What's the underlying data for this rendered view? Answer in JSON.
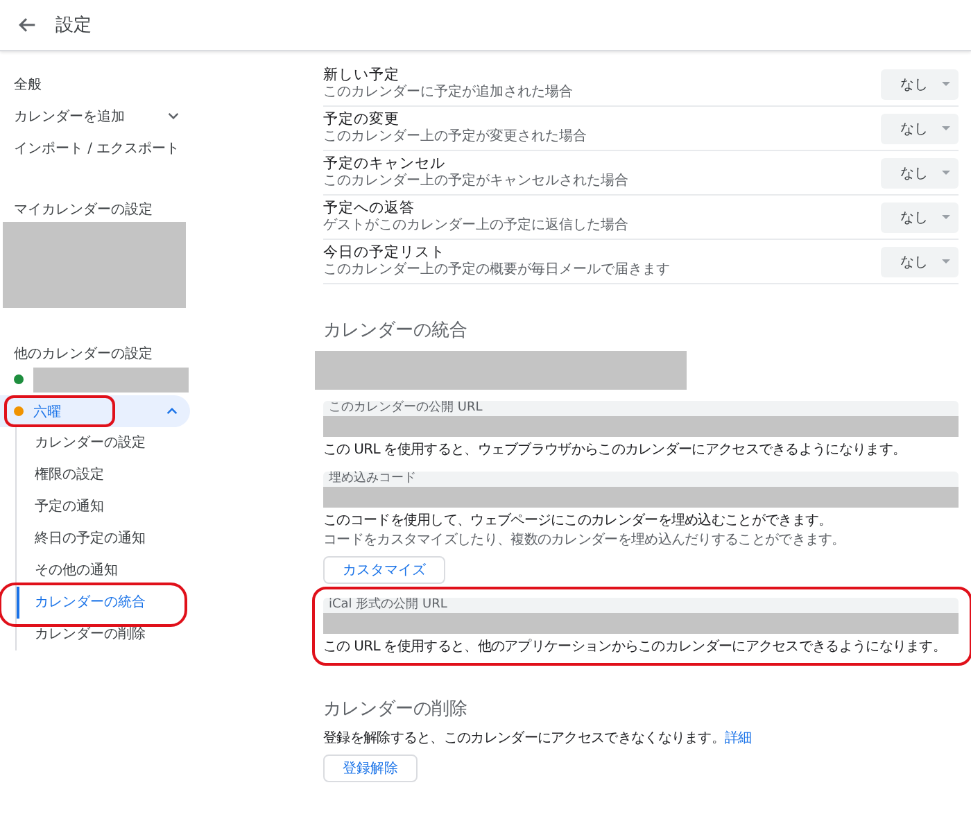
{
  "header": {
    "title": "設定"
  },
  "sidebar": {
    "nav": [
      {
        "label": "全般",
        "kind": "link"
      },
      {
        "label": "カレンダーを追加",
        "kind": "dropdown"
      },
      {
        "label": "インポート / エクスポート",
        "kind": "link"
      }
    ],
    "my_calendars": {
      "heading": "マイカレンダーの設定"
    },
    "other_calendars": {
      "heading": "他のカレンダーの設定",
      "calendars": [
        {
          "color": "#1e8e3e",
          "selected": false,
          "annotated": false
        },
        {
          "name": "六曜",
          "color": "#f09300",
          "selected": true,
          "expanded": true,
          "annotated": true,
          "children": [
            {
              "label": "カレンダーの設定",
              "selected": false,
              "annotated": false
            },
            {
              "label": "権限の設定",
              "selected": false,
              "annotated": false
            },
            {
              "label": "予定の通知",
              "selected": false,
              "annotated": false
            },
            {
              "label": "終日の予定の通知",
              "selected": false,
              "annotated": false
            },
            {
              "label": "その他の通知",
              "selected": false,
              "annotated": false
            },
            {
              "label": "カレンダーの統合",
              "selected": true,
              "annotated": true
            },
            {
              "label": "カレンダーの削除",
              "selected": false,
              "annotated": false
            }
          ]
        }
      ]
    }
  },
  "notifications": [
    {
      "title": "新しい予定",
      "description": "このカレンダーに予定が追加された場合",
      "value": "なし"
    },
    {
      "title": "予定の変更",
      "description": "このカレンダー上の予定が変更された場合",
      "value": "なし"
    },
    {
      "title": "予定のキャンセル",
      "description": "このカレンダー上の予定がキャンセルされた場合",
      "value": "なし"
    },
    {
      "title": "予定への返答",
      "description": "ゲストがこのカレンダー上の予定に返信した場合",
      "value": "なし"
    },
    {
      "title": "今日の予定リスト",
      "description": "このカレンダー上の予定の概要が毎日メールで届きます",
      "value": "なし"
    }
  ],
  "integration": {
    "heading": "カレンダーの統合",
    "fields": [
      {
        "label": "このカレンダーの公開 URL",
        "annotated": false,
        "notes": [
          {
            "text": "この URL を使用すると、ウェブブラウザからこのカレンダーにアクセスできるようになります。",
            "muted": false
          }
        ]
      },
      {
        "label": "埋め込みコード",
        "annotated": false,
        "notes": [
          {
            "text": "このコードを使用して、ウェブページにこのカレンダーを埋め込むことができます。",
            "muted": false
          },
          {
            "text": "コードをカスタマイズしたり、複数のカレンダーを埋め込んだりすることができます。",
            "muted": true
          }
        ],
        "button": "カスタマイズ"
      },
      {
        "label": "iCal 形式の公開 URL",
        "annotated": true,
        "notes": [
          {
            "text": "この URL を使用すると、他のアプリケーションからこのカレンダーにアクセスできるようになります。",
            "muted": false
          }
        ]
      }
    ]
  },
  "delete": {
    "heading": "カレンダーの削除",
    "description": "登録を解除すると、このカレンダーにアクセスできなくなります。",
    "link": "詳細",
    "button": "登録解除"
  }
}
